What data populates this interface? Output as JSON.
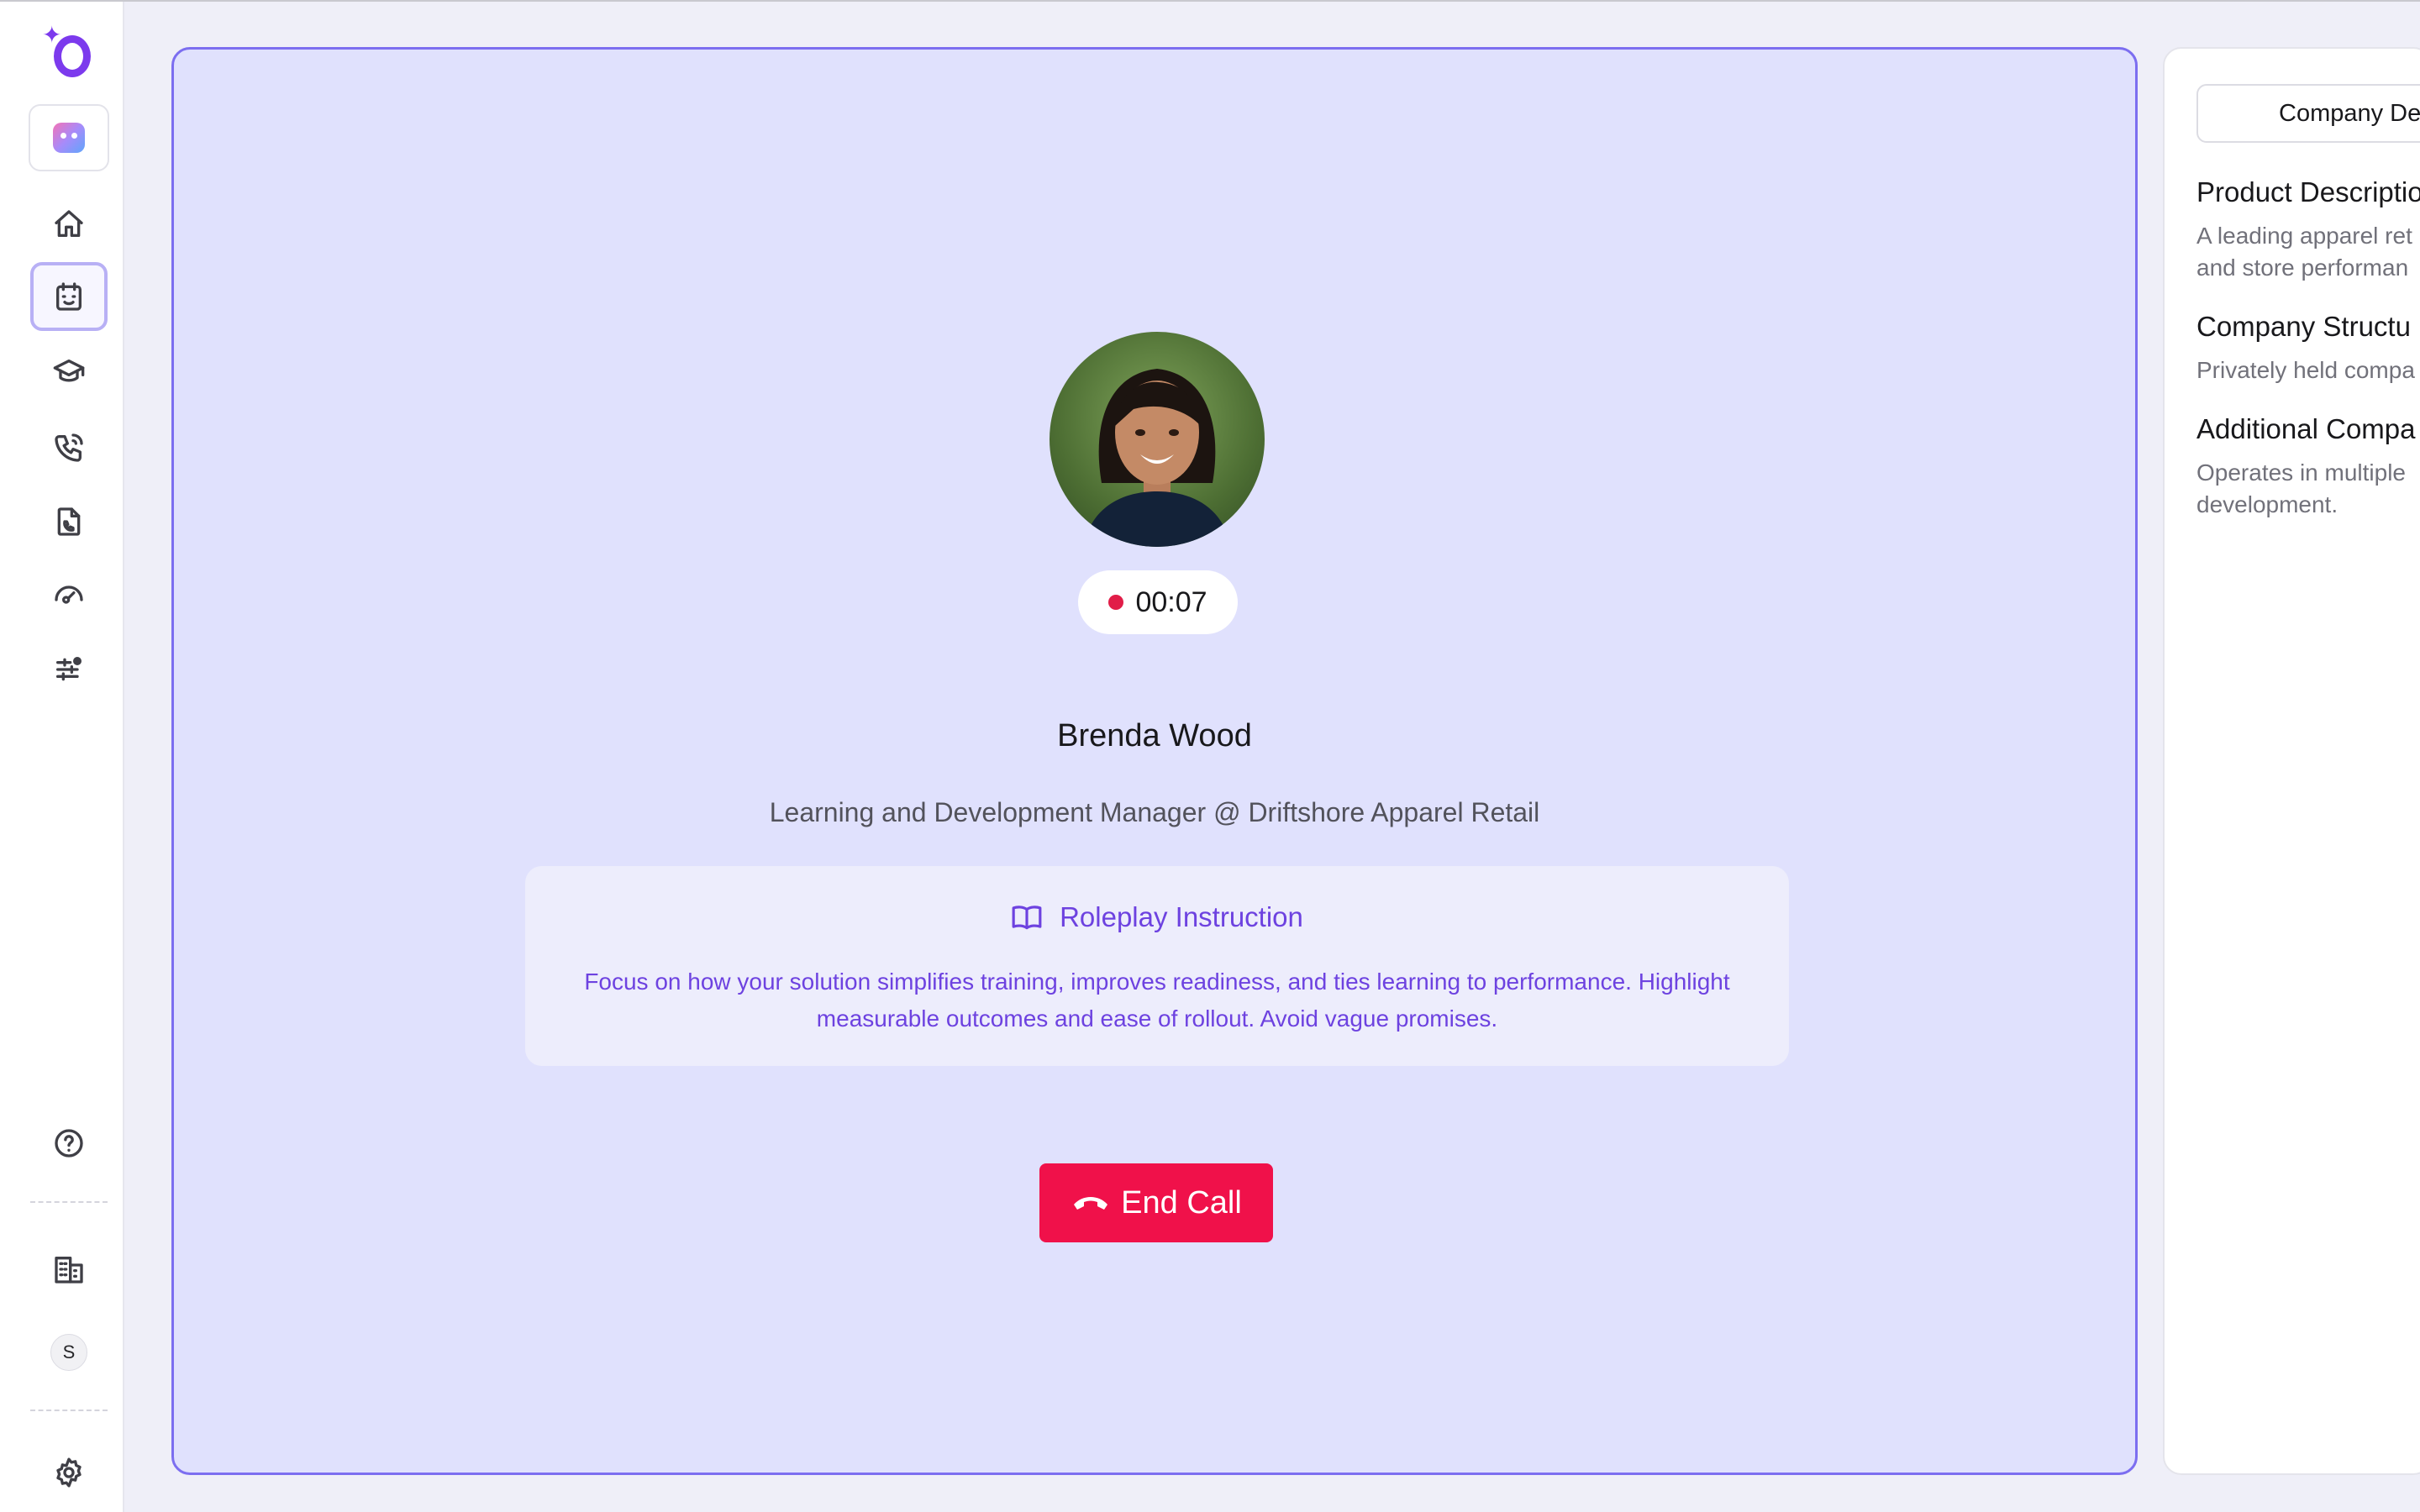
{
  "sidebar": {
    "nav": [
      {
        "icon": "home-icon"
      },
      {
        "icon": "calendar-icon",
        "active": true
      },
      {
        "icon": "graduation-cap-icon"
      },
      {
        "icon": "phone-call-icon"
      },
      {
        "icon": "phone-file-icon"
      },
      {
        "icon": "speedometer-icon"
      },
      {
        "icon": "sliders-icon"
      }
    ],
    "user_initial": "S"
  },
  "call": {
    "timer": "00:07",
    "contact_name": "Brenda Wood",
    "contact_role": "Learning and Development Manager @ Driftshore Apparel Retail",
    "instruction_title": "Roleplay Instruction",
    "instruction_text": "Focus on how your solution simplifies training, improves readiness, and ties learning to performance. Highlight measurable outcomes and ease of rollout. Avoid vague promises.",
    "end_call_label": "End Call"
  },
  "right_panel": {
    "tab_label": "Company De",
    "sections": [
      {
        "title": "Product Descriptio",
        "lines": [
          "A leading apparel ret",
          "and store performan"
        ]
      },
      {
        "title": "Company Structu",
        "lines": [
          "Privately held compa"
        ]
      },
      {
        "title": "Additional Compa",
        "lines": [
          "Operates in multiple",
          "development."
        ]
      }
    ]
  },
  "colors": {
    "accent": "#7c3aed",
    "card_bg": "#e0e1fd",
    "end_call": "#f0114a",
    "recording": "#e11d48"
  }
}
